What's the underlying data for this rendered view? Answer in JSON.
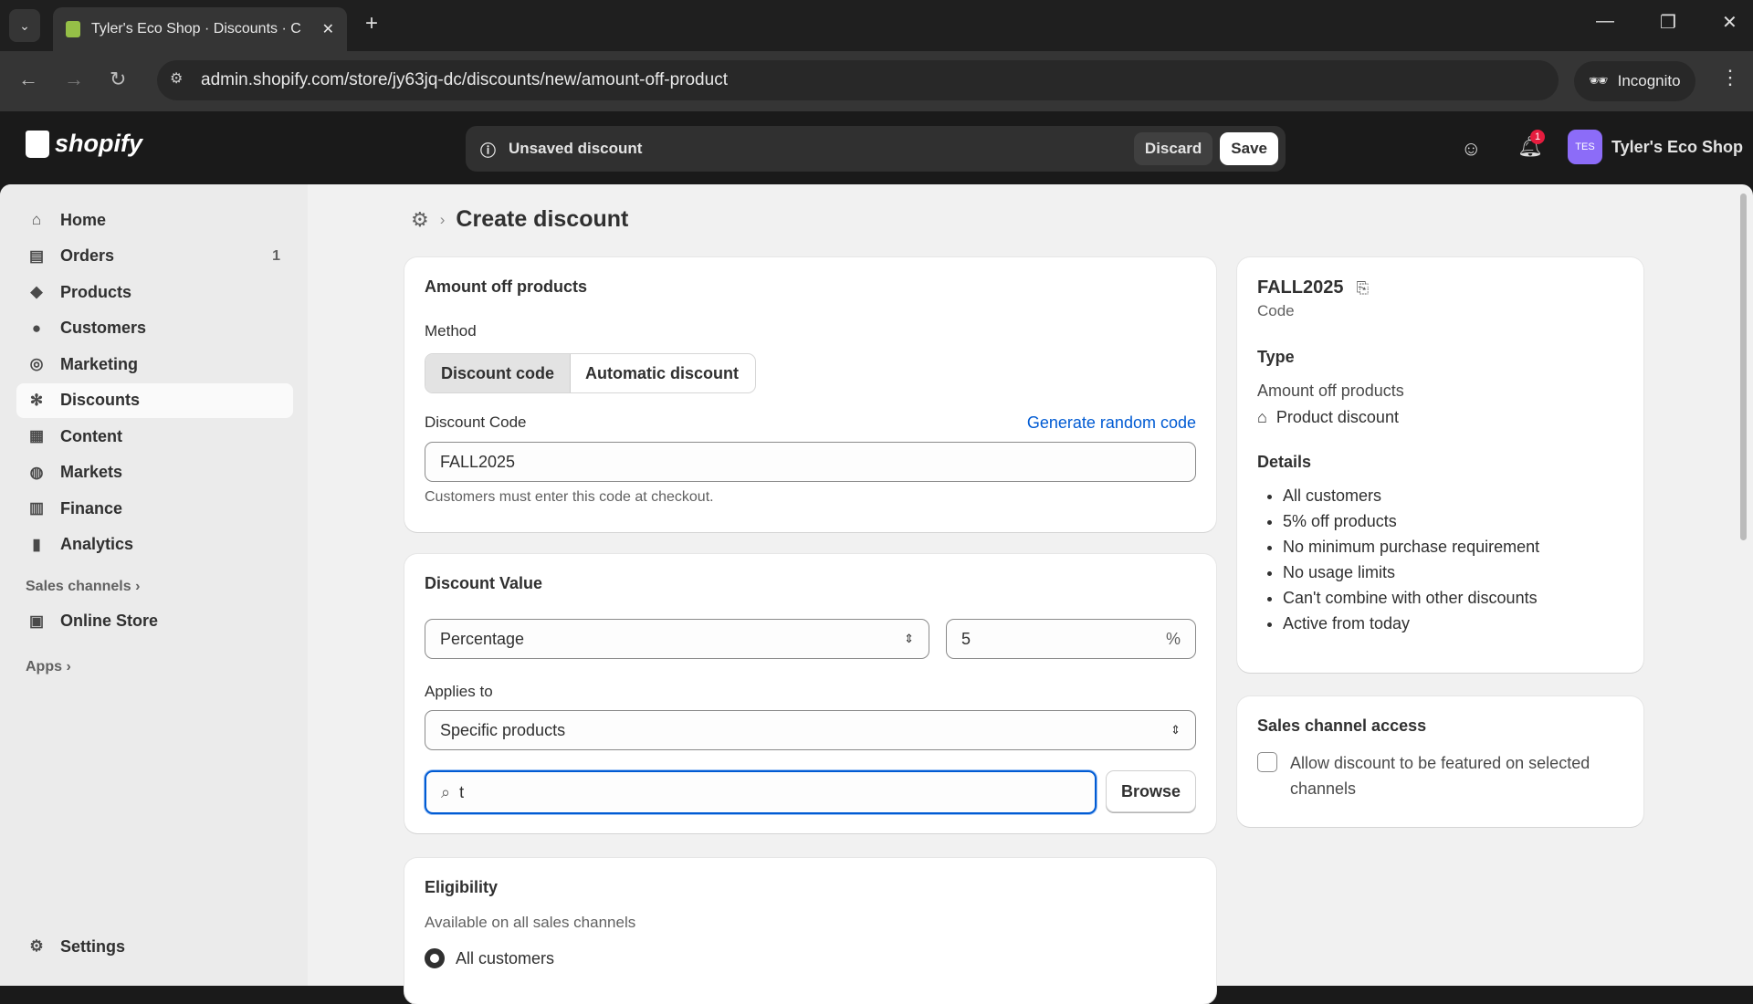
{
  "browser": {
    "tab_title": "Tyler's Eco Shop · Discounts · C",
    "url": "admin.shopify.com/store/jy63jq-dc/discounts/new/amount-off-product",
    "incognito": "Incognito"
  },
  "topbar": {
    "logo": "shopify",
    "status": "Unsaved discount",
    "discard": "Discard",
    "save": "Save",
    "notification_count": "1",
    "avatar": "TES",
    "store": "Tyler's Eco Shop"
  },
  "sidebar": {
    "items": [
      {
        "label": "Home",
        "icon": "home-icon"
      },
      {
        "label": "Orders",
        "icon": "orders-icon",
        "badge": "1"
      },
      {
        "label": "Products",
        "icon": "tag-icon"
      },
      {
        "label": "Customers",
        "icon": "person-icon"
      },
      {
        "label": "Marketing",
        "icon": "target-icon"
      },
      {
        "label": "Discounts",
        "icon": "discount-icon"
      },
      {
        "label": "Content",
        "icon": "content-icon"
      },
      {
        "label": "Markets",
        "icon": "globe-icon"
      },
      {
        "label": "Finance",
        "icon": "bank-icon"
      },
      {
        "label": "Analytics",
        "icon": "chart-icon"
      }
    ],
    "sales_channels": "Sales channels",
    "online_store": "Online Store",
    "apps": "Apps",
    "settings": "Settings"
  },
  "page": {
    "title": "Create discount"
  },
  "method_card": {
    "title": "Amount off products",
    "method_label": "Method",
    "method_options": [
      "Discount code",
      "Automatic discount"
    ],
    "code_label": "Discount Code",
    "generate": "Generate random code",
    "code_value": "FALL2025",
    "help": "Customers must enter this code at checkout."
  },
  "value_card": {
    "title": "Discount Value",
    "type": "Percentage",
    "value": "5",
    "suffix": "%",
    "applies_label": "Applies to",
    "applies_value": "Specific products",
    "search_value": "t",
    "browse": "Browse"
  },
  "eligibility": {
    "title": "Eligibility",
    "subtitle": "Available on all sales channels",
    "option": "All customers"
  },
  "summary": {
    "code": "FALL2025",
    "code_label": "Code",
    "type_title": "Type",
    "type_value": "Amount off products",
    "type_sub": "Product discount",
    "details_title": "Details",
    "details": [
      "All customers",
      "5% off products",
      "No minimum purchase requirement",
      "No usage limits",
      "Can't combine with other discounts",
      "Active from today"
    ]
  },
  "channel": {
    "title": "Sales channel access",
    "checkbox": "Allow discount to be featured on selected channels"
  }
}
